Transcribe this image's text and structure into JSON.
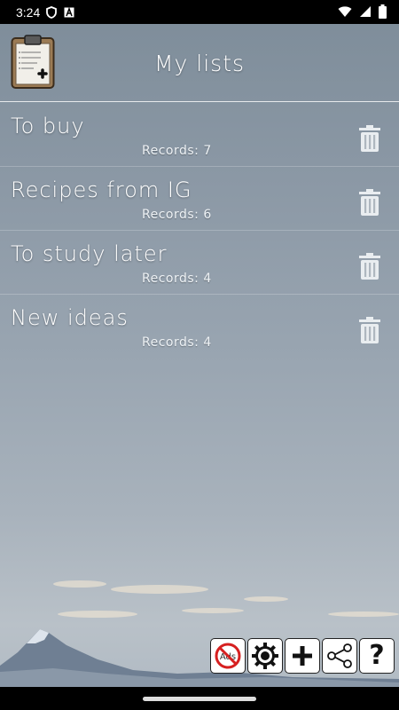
{
  "status_bar": {
    "time": "3:24",
    "icons_left": [
      "shield-icon",
      "a-badge-icon"
    ],
    "icons_right": [
      "wifi-icon",
      "signal-icon",
      "battery-icon"
    ]
  },
  "header": {
    "title": "My lists",
    "icon": "clipboard-add-icon"
  },
  "lists": [
    {
      "title": "To buy",
      "records": "Records: 7"
    },
    {
      "title": "Recipes from IG",
      "records": "Records: 6"
    },
    {
      "title": "To study later",
      "records": "Records: 4"
    },
    {
      "title": "New ideas",
      "records": "Records: 4"
    }
  ],
  "toolbar": {
    "buttons": [
      "no-ads-icon",
      "settings-gear-icon",
      "plus-icon",
      "share-icon",
      "help-icon"
    ],
    "no_ads_text": "Ads",
    "help_text": "?"
  },
  "colors": {
    "background_top": "#7d8c99",
    "background_bottom": "#b9c1c8",
    "text": "#ffffff"
  }
}
